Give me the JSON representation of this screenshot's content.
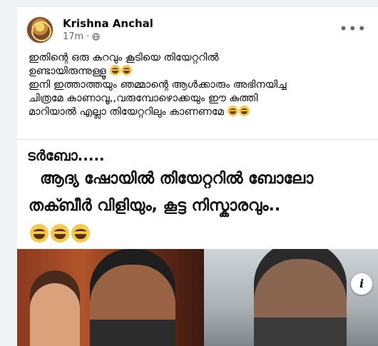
{
  "post": {
    "author": "Krishna Anchal",
    "time": "17m",
    "privacy_icon": "globe-icon",
    "more_label": "•••",
    "text_line1": "ഇതിന്റെ ഒരു കുറവും കൂടിയെ തിയേറ്ററിൽ",
    "text_line2": "ഉണ്ടായിരുന്നുള്ളൂ",
    "text_line3": "ഇനി ഇത്താത്തയും ഞമ്മാന്റെ ആൾക്കാരും അഭിനയിച്ച",
    "text_line4": "ചിത്രമേ കാണാവൂ,,വരുമ്പോഴൊക്കയും ഈ കുത്തി",
    "text_line5": "മാറിയാൽ എല്ലാ തിയേറ്ററിലും കാണണമേ"
  },
  "meme": {
    "title": "ടർബോ.....",
    "line1": "ആദ്യ ഷോയിൽ തിയേറ്ററിൽ ബോലോ",
    "line2": "തക്ബീർ വിളിയും, കൂട്ട നിസ്കാരവും..",
    "info_label": "i"
  },
  "colors": {
    "text": "#050505",
    "secondary": "#65676b",
    "background": "#f0f2f5"
  }
}
